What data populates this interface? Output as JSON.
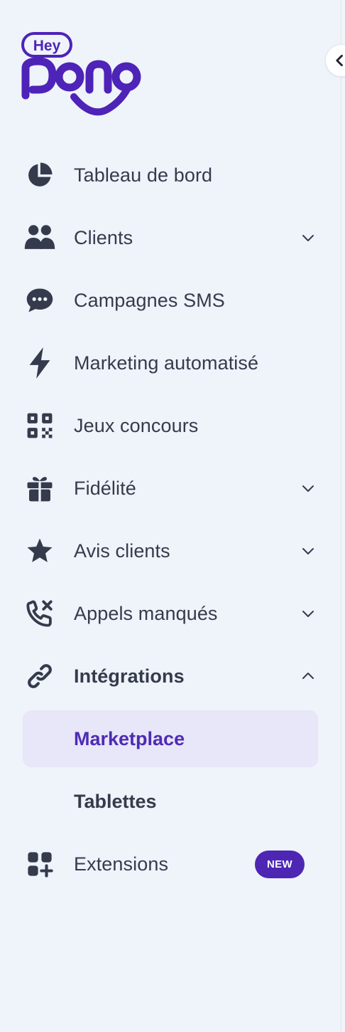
{
  "brand": {
    "badge_text": "Hey",
    "wordmark": "pongo",
    "color": "#4e23b8"
  },
  "collapse_button": {
    "icon": "chevron-left-icon"
  },
  "nav": {
    "items": [
      {
        "label": "Tableau de bord",
        "icon": "pie-chart-icon",
        "expandable": false
      },
      {
        "label": "Clients",
        "icon": "users-icon",
        "expandable": true,
        "expanded": false
      },
      {
        "label": "Campagnes SMS",
        "icon": "chat-bubble-icon",
        "expandable": false
      },
      {
        "label": "Marketing automatisé",
        "icon": "lightning-bolt-icon",
        "expandable": false
      },
      {
        "label": "Jeux concours",
        "icon": "qr-code-icon",
        "expandable": false
      },
      {
        "label": "Fidélité",
        "icon": "gift-icon",
        "expandable": true,
        "expanded": false
      },
      {
        "label": "Avis clients",
        "icon": "star-icon",
        "expandable": true,
        "expanded": false
      },
      {
        "label": "Appels manqués",
        "icon": "missed-call-icon",
        "expandable": true,
        "expanded": false
      },
      {
        "label": "Intégrations",
        "icon": "link-icon",
        "expandable": true,
        "expanded": true
      },
      {
        "label": "Extensions",
        "icon": "apps-add-icon",
        "expandable": false,
        "badge": "NEW"
      }
    ],
    "integrations_sub": [
      {
        "label": "Marketplace",
        "active": true
      },
      {
        "label": "Tablettes",
        "active": false
      }
    ]
  },
  "colors": {
    "background": "#eff3fa",
    "text": "#353b4c",
    "icon": "#353b4c",
    "accent": "#4d27b3",
    "active_bg": "#e8e6f9"
  }
}
